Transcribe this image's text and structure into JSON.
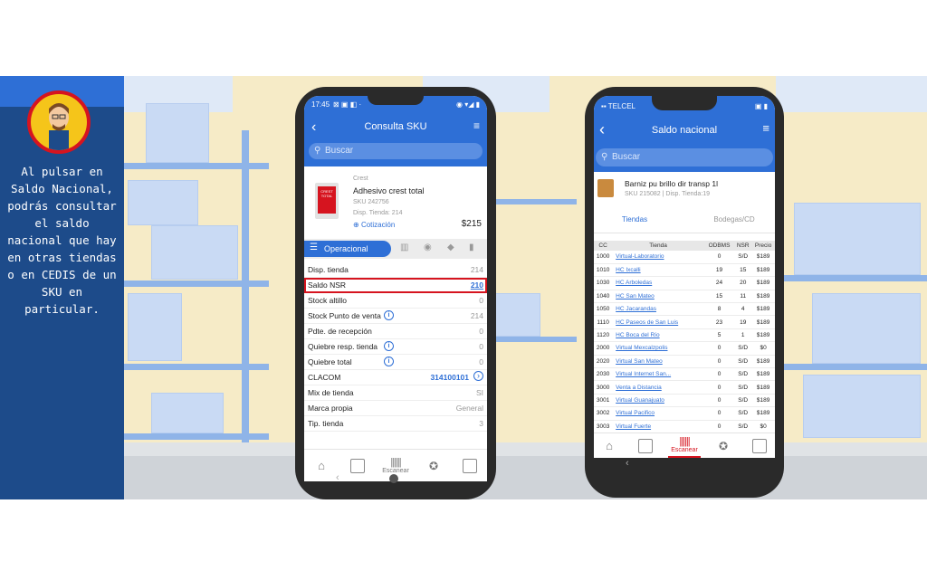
{
  "caption": "Al pulsar en Saldo Nacional, podrás consultar el saldo nacional que hay en otras tiendas o en CEDIS de un SKU en particular.",
  "phone1": {
    "status": {
      "time": "17:45",
      "icons": "⊠ ▣ ◧ ·",
      "right": "◉ ▾◢ ▮"
    },
    "title": "Consulta SKU",
    "search_placeholder": "Buscar",
    "product": {
      "brand": "Crest",
      "name": "Adhesivo crest total",
      "sku": "SKU 242756",
      "disp": "Disp. Tienda: 214",
      "cotizacion": "Cotización",
      "price": "$215",
      "image_text": "CREST TOTAL"
    },
    "tab_active": "Operacional",
    "rows": [
      {
        "label": "Disp. tienda",
        "value": "214",
        "info": false
      },
      {
        "label": "Saldo NSR",
        "value": "210",
        "info": false,
        "highlight": true
      },
      {
        "label": "Stock altillo",
        "value": "0",
        "info": false
      },
      {
        "label": "Stock Punto de venta",
        "value": "214",
        "info": true
      },
      {
        "label": "Pdte. de recepción",
        "value": "0",
        "info": false
      },
      {
        "label": "Quiebre resp. tienda",
        "value": "0",
        "info": true
      },
      {
        "label": "Quiebre total",
        "value": "0",
        "info": true
      },
      {
        "label": "CLACOM",
        "value": "314100101",
        "info": false,
        "arrow": true
      },
      {
        "label": "Mix de tienda",
        "value": "SI",
        "info": false
      },
      {
        "label": "Marca propia",
        "value": "General",
        "info": false
      },
      {
        "label": "Tip. tienda",
        "value": "3",
        "info": false
      }
    ],
    "nav": {
      "scan_label": "Escanear"
    },
    "back_glyph": "‹"
  },
  "phone2": {
    "status": {
      "carrier": "▪▪ TELCEL",
      "right": "▣ ▮"
    },
    "title": "Saldo nacional",
    "search_placeholder": "Buscar",
    "product": {
      "name": "Barniz pu brillo dir transp 1l",
      "meta": "SKU 215082 | Disp. Tienda:19"
    },
    "tabs": [
      "Tiendas",
      "Bodegas/CD"
    ],
    "table": {
      "headers": [
        "CC",
        "Tienda",
        "ODBMS",
        "NSR",
        "Precio"
      ],
      "rows": [
        [
          "1000",
          "Virtual-Laboratorio",
          "0",
          "S/D",
          "$189"
        ],
        [
          "1010",
          "HC Ixcalli",
          "19",
          "15",
          "$189"
        ],
        [
          "1030",
          "HC Arboledas",
          "24",
          "20",
          "$189"
        ],
        [
          "1040",
          "HC San Mateo",
          "15",
          "11",
          "$189"
        ],
        [
          "1050",
          "HC Jacarandas",
          "8",
          "4",
          "$189"
        ],
        [
          "1110",
          "HC Paseos de San Luis",
          "23",
          "19",
          "$189"
        ],
        [
          "1120",
          "HC Boca del Río",
          "5",
          "1",
          "$189"
        ],
        [
          "2000",
          "Virtual Mexcalzpolis",
          "0",
          "S/D",
          "$0"
        ],
        [
          "2020",
          "Virtual San Mateo",
          "0",
          "S/D",
          "$189"
        ],
        [
          "2030",
          "Virtual Internet San...",
          "0",
          "S/D",
          "$189"
        ],
        [
          "3000",
          "Venta a Distancia",
          "0",
          "S/D",
          "$189"
        ],
        [
          "3001",
          "Virtual Guanajuato",
          "0",
          "S/D",
          "$189"
        ],
        [
          "3002",
          "Virtual Pacifico",
          "0",
          "S/D",
          "$189"
        ],
        [
          "3003",
          "Virtual Fuerte",
          "0",
          "S/D",
          "$0"
        ]
      ]
    },
    "nav": {
      "scan_label": "Escanear"
    },
    "back_glyph": "‹"
  },
  "colors": {
    "primary": "#2e6fd6",
    "sidebar": "#1d4b8a",
    "highlight": "#d6141f",
    "scan_active": "#d6141f"
  }
}
